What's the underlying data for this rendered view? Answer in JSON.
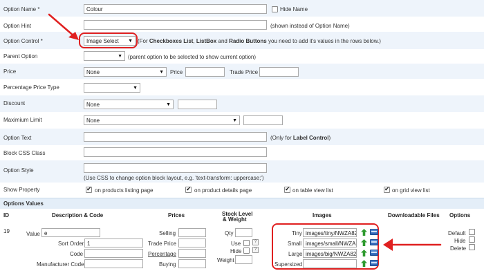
{
  "form": {
    "option_name": {
      "label": "Option Name *",
      "value": "Colour",
      "hide_label": "Hide Name"
    },
    "option_hint": {
      "label": "Option Hint",
      "value": "",
      "note": "(shown instead of Option Name)"
    },
    "option_control": {
      "label": "Option Control *",
      "value": "Image Select",
      "note_prefix": "(For ",
      "note_b1": "Checkboxes List",
      "note_s1": ", ",
      "note_b2": "ListBox",
      "note_s2": " and ",
      "note_b3": "Radio Buttons",
      "note_suffix": " you need to add it's values in the rows below.)"
    },
    "parent_option": {
      "label": "Parent Option",
      "value": "",
      "note": "(parent option to be selected to show current option)"
    },
    "price": {
      "label": "Price",
      "value": "None",
      "price_label": "Price",
      "trade_label": "Trade Price"
    },
    "percentage_price_type": {
      "label": "Percentage Price Type",
      "value": ""
    },
    "discount": {
      "label": "Discount",
      "value": "None"
    },
    "maximum_limit": {
      "label": "Maximium Limit",
      "value": "None"
    },
    "option_text": {
      "label": "Option Text",
      "note_prefix": "(Only for ",
      "note_bold": "Label Control",
      "note_suffix": ")"
    },
    "block_css_class": {
      "label": "Block CSS Class"
    },
    "option_style": {
      "label": "Option Style",
      "note": "(Use CSS to change option block layout, e.g. 'text-transform: uppercase;')"
    },
    "show_property": {
      "label": "Show Property",
      "items": [
        "on products listing page",
        "on product details page",
        "on table view list",
        "on grid view list"
      ]
    }
  },
  "options_values": {
    "section_title": "Options Values",
    "headers": {
      "id": "ID",
      "desc": "Description & Code",
      "prices": "Prices",
      "stock1": "Stock Level",
      "stock2": "& Weight",
      "images": "Images",
      "downloads": "Downloadable Files",
      "options": "Options"
    },
    "row": {
      "id": "19",
      "value_label": "Value",
      "value": "e",
      "sort_order_label": "Sort Order",
      "sort_order": "1",
      "code_label": "Code",
      "manufacturer_code_label": "Manufacturer Code",
      "selling_label": "Selling",
      "trade_price_label": "Trade Price",
      "percentage_label": "Percentage",
      "buying_label": "Buying",
      "qty_label": "Qty",
      "use_label": "Use",
      "hide_label": "Hide",
      "weight_label": "Weight",
      "help_glyph": "?",
      "images": {
        "tiny_label": "Tiny",
        "tiny": "images/tiny/NWZA82",
        "small_label": "Small",
        "small": "images/small/NWZA82",
        "large_label": "Large",
        "large": "images/big/NWZA82",
        "supersized_label": "Supersized",
        "supersized": ""
      },
      "default_label": "Default",
      "opt_hide_label": "Hide",
      "delete_label": "Delete"
    }
  },
  "colors": {
    "row_alt": "#eef4fb",
    "section_bg": "#e4eef8",
    "annotation_red": "#e02020",
    "arrow_green": "#2e9a2e"
  }
}
